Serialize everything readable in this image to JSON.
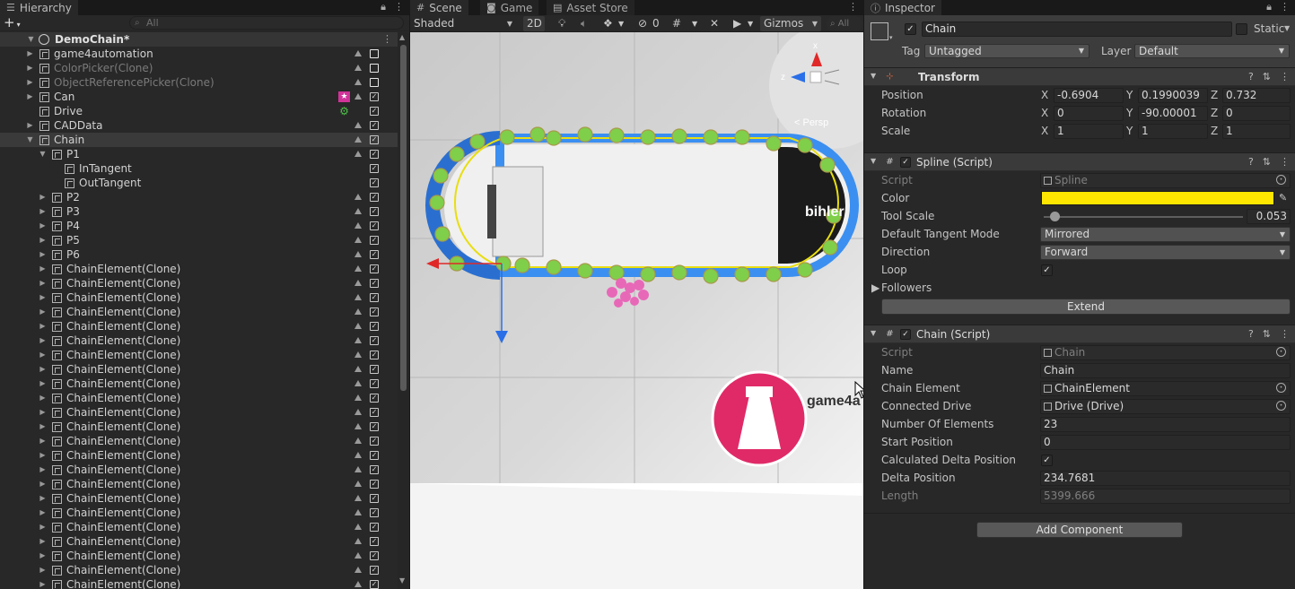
{
  "hierarchy": {
    "tab_label": "Hierarchy",
    "search_placeholder": "All",
    "root": "DemoChain*",
    "rows": [
      {
        "label": "game4automation",
        "indent": 1,
        "arrow": "right",
        "tri": true,
        "chk": "empty",
        "dim": false
      },
      {
        "label": "ColorPicker(Clone)",
        "indent": 1,
        "arrow": "right",
        "tri": true,
        "chk": "empty",
        "dim": true
      },
      {
        "label": "ObjectReferencePicker(Clone)",
        "indent": 1,
        "arrow": "right",
        "tri": true,
        "chk": "empty",
        "dim": true
      },
      {
        "label": "Can",
        "indent": 1,
        "arrow": "right",
        "tri": true,
        "chk": "check",
        "badge": "star"
      },
      {
        "label": "Drive",
        "indent": 1,
        "arrow": "none",
        "tri": false,
        "chk": "check",
        "badge": "gear"
      },
      {
        "label": "CADData",
        "indent": 1,
        "arrow": "right",
        "tri": true,
        "chk": "check"
      },
      {
        "label": "Chain",
        "indent": 1,
        "arrow": "down",
        "tri": true,
        "chk": "check",
        "selected": true
      },
      {
        "label": "P1",
        "indent": 2,
        "arrow": "down",
        "tri": true,
        "chk": "check"
      },
      {
        "label": "InTangent",
        "indent": 3,
        "arrow": "none",
        "tri": false,
        "chk": "check"
      },
      {
        "label": "OutTangent",
        "indent": 3,
        "arrow": "none",
        "tri": false,
        "chk": "check"
      },
      {
        "label": "P2",
        "indent": 2,
        "arrow": "right",
        "tri": true,
        "chk": "check"
      },
      {
        "label": "P3",
        "indent": 2,
        "arrow": "right",
        "tri": true,
        "chk": "check"
      },
      {
        "label": "P4",
        "indent": 2,
        "arrow": "right",
        "tri": true,
        "chk": "check"
      },
      {
        "label": "P5",
        "indent": 2,
        "arrow": "right",
        "tri": true,
        "chk": "check"
      },
      {
        "label": "P6",
        "indent": 2,
        "arrow": "right",
        "tri": true,
        "chk": "check"
      },
      {
        "label": "ChainElement(Clone)",
        "indent": 2,
        "arrow": "right",
        "tri": true,
        "chk": "check"
      },
      {
        "label": "ChainElement(Clone)",
        "indent": 2,
        "arrow": "right",
        "tri": true,
        "chk": "check"
      },
      {
        "label": "ChainElement(Clone)",
        "indent": 2,
        "arrow": "right",
        "tri": true,
        "chk": "check"
      },
      {
        "label": "ChainElement(Clone)",
        "indent": 2,
        "arrow": "right",
        "tri": true,
        "chk": "check"
      },
      {
        "label": "ChainElement(Clone)",
        "indent": 2,
        "arrow": "right",
        "tri": true,
        "chk": "check"
      },
      {
        "label": "ChainElement(Clone)",
        "indent": 2,
        "arrow": "right",
        "tri": true,
        "chk": "check"
      },
      {
        "label": "ChainElement(Clone)",
        "indent": 2,
        "arrow": "right",
        "tri": true,
        "chk": "check"
      },
      {
        "label": "ChainElement(Clone)",
        "indent": 2,
        "arrow": "right",
        "tri": true,
        "chk": "check"
      },
      {
        "label": "ChainElement(Clone)",
        "indent": 2,
        "arrow": "right",
        "tri": true,
        "chk": "check"
      },
      {
        "label": "ChainElement(Clone)",
        "indent": 2,
        "arrow": "right",
        "tri": true,
        "chk": "check"
      },
      {
        "label": "ChainElement(Clone)",
        "indent": 2,
        "arrow": "right",
        "tri": true,
        "chk": "check"
      },
      {
        "label": "ChainElement(Clone)",
        "indent": 2,
        "arrow": "right",
        "tri": true,
        "chk": "check"
      },
      {
        "label": "ChainElement(Clone)",
        "indent": 2,
        "arrow": "right",
        "tri": true,
        "chk": "check"
      },
      {
        "label": "ChainElement(Clone)",
        "indent": 2,
        "arrow": "right",
        "tri": true,
        "chk": "check"
      },
      {
        "label": "ChainElement(Clone)",
        "indent": 2,
        "arrow": "right",
        "tri": true,
        "chk": "check"
      },
      {
        "label": "ChainElement(Clone)",
        "indent": 2,
        "arrow": "right",
        "tri": true,
        "chk": "check"
      },
      {
        "label": "ChainElement(Clone)",
        "indent": 2,
        "arrow": "right",
        "tri": true,
        "chk": "check"
      },
      {
        "label": "ChainElement(Clone)",
        "indent": 2,
        "arrow": "right",
        "tri": true,
        "chk": "check"
      },
      {
        "label": "ChainElement(Clone)",
        "indent": 2,
        "arrow": "right",
        "tri": true,
        "chk": "check"
      },
      {
        "label": "ChainElement(Clone)",
        "indent": 2,
        "arrow": "right",
        "tri": true,
        "chk": "check"
      },
      {
        "label": "ChainElement(Clone)",
        "indent": 2,
        "arrow": "right",
        "tri": true,
        "chk": "check"
      },
      {
        "label": "ChainElement(Clone)",
        "indent": 2,
        "arrow": "right",
        "tri": true,
        "chk": "check"
      },
      {
        "label": "ChainElement(Clone)",
        "indent": 2,
        "arrow": "right",
        "tri": true,
        "chk": "check"
      }
    ]
  },
  "scene": {
    "tabs": {
      "scene": "Scene",
      "game": "Game",
      "store": "Asset Store"
    },
    "toolbar": {
      "shading": "Shaded",
      "mode2d": "2D",
      "hidden_count": "0",
      "gizmos": "Gizmos",
      "search": "All"
    },
    "gizmo_labels": {
      "x": "x",
      "z": "z",
      "persp": "< Persp"
    },
    "logo_text": "game4a",
    "model_text": "bihler"
  },
  "inspector": {
    "tab_label": "Inspector",
    "object": {
      "name": "Chain",
      "static_label": "Static",
      "tag_label": "Tag",
      "tag_value": "Untagged",
      "layer_label": "Layer",
      "layer_value": "Default"
    },
    "transform": {
      "title": "Transform",
      "position_label": "Position",
      "rotation_label": "Rotation",
      "scale_label": "Scale",
      "x": "X",
      "y": "Y",
      "z": "Z",
      "position": [
        "-0.6904",
        "0.1990039",
        "0.732"
      ],
      "rotation": [
        "0",
        "-90.00001",
        "0"
      ],
      "scale": [
        "1",
        "1",
        "1"
      ]
    },
    "spline": {
      "title": "Spline (Script)",
      "script_label": "Script",
      "script_value": "Spline",
      "color_label": "Color",
      "color_value": "#ffe600",
      "toolscale_label": "Tool Scale",
      "toolscale_value": "0.053",
      "tangent_label": "Default Tangent Mode",
      "tangent_value": "Mirrored",
      "direction_label": "Direction",
      "direction_value": "Forward",
      "loop_label": "Loop",
      "loop_checked": true,
      "followers_label": "Followers",
      "extend_button": "Extend"
    },
    "chain": {
      "title": "Chain (Script)",
      "script_label": "Script",
      "script_value": "Chain",
      "name_label": "Name",
      "name_value": "Chain",
      "element_label": "Chain Element",
      "element_value": "ChainElement",
      "drive_label": "Connected Drive",
      "drive_value": "Drive (Drive)",
      "count_label": "Number Of Elements",
      "count_value": "23",
      "start_label": "Start Position",
      "start_value": "0",
      "calc_label": "Calculated Delta Position",
      "calc_checked": true,
      "delta_label": "Delta Position",
      "delta_value": "234.7681",
      "length_label": "Length",
      "length_value": "5399.666"
    },
    "add_component": "Add Component"
  }
}
